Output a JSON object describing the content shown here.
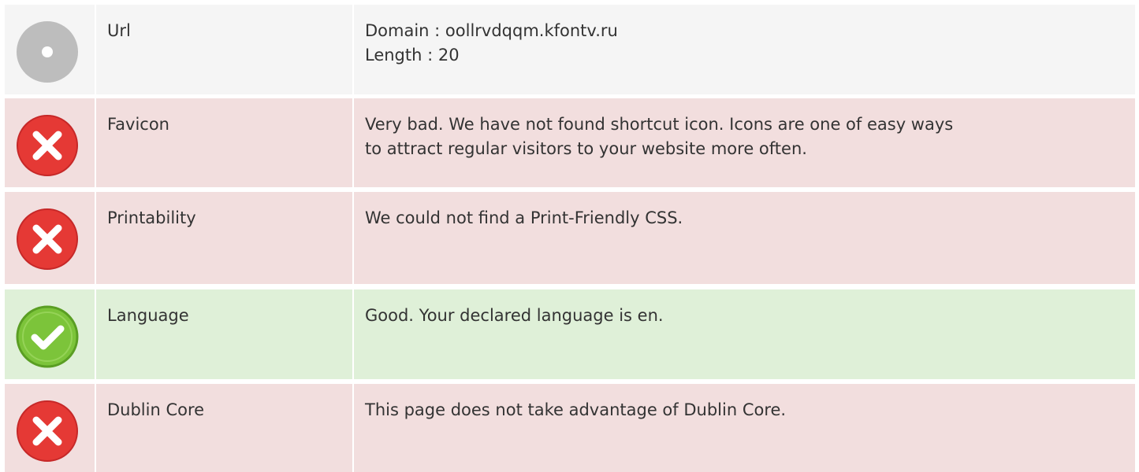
{
  "rows": [
    {
      "status": "neutral",
      "icon": "info-dot-icon",
      "label": "Url",
      "lines": [
        "Domain : oollrvdqqm.kfontv.ru",
        "Length : 20"
      ]
    },
    {
      "status": "bad",
      "icon": "error-x-icon",
      "label": "Favicon",
      "lines": [
        "Very bad. We have not found shortcut icon. Icons are one of easy ways",
        "to attract regular visitors to your website more often."
      ]
    },
    {
      "status": "bad",
      "icon": "error-x-icon",
      "label": "Printability",
      "lines": [
        "We could not find a Print-Friendly CSS."
      ]
    },
    {
      "status": "good",
      "icon": "check-icon",
      "label": "Language",
      "lines": [
        "Good. Your declared language is en."
      ]
    },
    {
      "status": "bad",
      "icon": "error-x-icon",
      "label": "Dublin Core",
      "lines": [
        "This page does not take advantage of Dublin Core."
      ]
    }
  ],
  "colors": {
    "neutral": "#f5f5f5",
    "bad": "#f2dede",
    "good": "#dff0d8",
    "error_icon": "#e53935",
    "check_icon": "#7cc43a",
    "neutral_icon": "#bdbdbd"
  }
}
